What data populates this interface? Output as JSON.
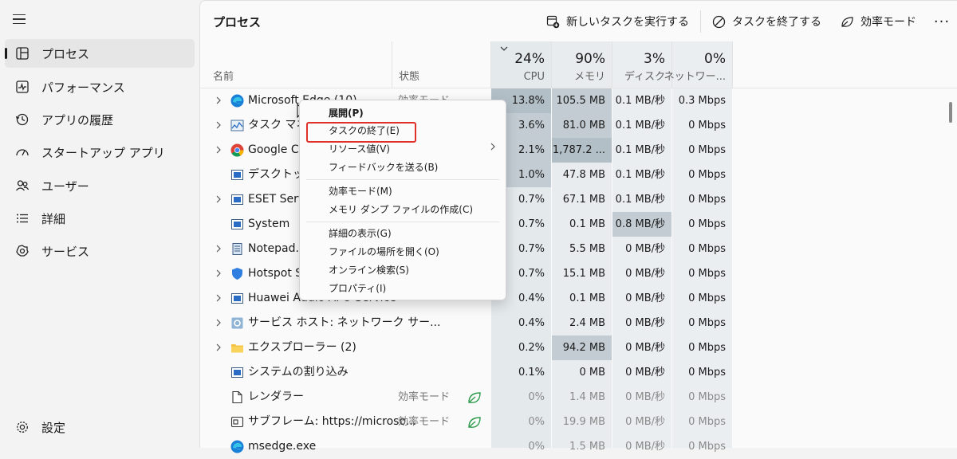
{
  "sidebar": {
    "items": [
      {
        "label": "プロセス",
        "icon": "processes-icon"
      },
      {
        "label": "パフォーマンス",
        "icon": "performance-icon"
      },
      {
        "label": "アプリの履歴",
        "icon": "history-icon"
      },
      {
        "label": "スタートアップ アプリ",
        "icon": "startup-icon"
      },
      {
        "label": "ユーザー",
        "icon": "users-icon"
      },
      {
        "label": "詳細",
        "icon": "details-icon"
      },
      {
        "label": "サービス",
        "icon": "services-icon"
      }
    ],
    "settings_label": "設定"
  },
  "header": {
    "title": "プロセス",
    "run_task": "新しいタスクを実行する",
    "end_task": "タスクを終了する",
    "efficiency": "効率モード",
    "more": "···"
  },
  "columns": {
    "name": "名前",
    "status": "状態",
    "cpu_pct": "24%",
    "cpu": "CPU",
    "mem_pct": "90%",
    "mem": "メモリ",
    "disk_pct": "3%",
    "disk": "ディスク",
    "net_pct": "0%",
    "net": "ネットワー..."
  },
  "processes": [
    {
      "name": "Microsoft Edge (10)",
      "status": "効率モード",
      "cpu": "13.8%",
      "mem": "105.5 MB",
      "disk": "0.1 MB/秒",
      "net": "0.3 Mbps"
    },
    {
      "name": "タスク マネージャー",
      "status": "",
      "cpu": "3.6%",
      "mem": "81.0 MB",
      "disk": "0.1 MB/秒",
      "net": "0 Mbps"
    },
    {
      "name": "Google Chrome",
      "status": "",
      "cpu": "2.1%",
      "mem": "1,787.2 ...",
      "disk": "0.1 MB/秒",
      "net": "0 Mbps"
    },
    {
      "name": "デスクトップ ウィンドウ マネージャー",
      "status": "",
      "cpu": "1.0%",
      "mem": "47.8 MB",
      "disk": "0.1 MB/秒",
      "net": "0 Mbps"
    },
    {
      "name": "ESET Service",
      "status": "",
      "cpu": "0.7%",
      "mem": "67.1 MB",
      "disk": "0.1 MB/秒",
      "net": "0 Mbps"
    },
    {
      "name": "System",
      "status": "",
      "cpu": "0.7%",
      "mem": "0.1 MB",
      "disk": "0.8 MB/秒",
      "net": "0 Mbps"
    },
    {
      "name": "Notepad.exe",
      "status": "",
      "cpu": "0.7%",
      "mem": "5.5 MB",
      "disk": "0 MB/秒",
      "net": "0 Mbps"
    },
    {
      "name": "Hotspot Shield",
      "status": "",
      "cpu": "0.7%",
      "mem": "15.1 MB",
      "disk": "0 MB/秒",
      "net": "0 Mbps"
    },
    {
      "name": "Huawei Audio APO Service",
      "status": "",
      "cpu": "0.4%",
      "mem": "0.1 MB",
      "disk": "0 MB/秒",
      "net": "0 Mbps"
    },
    {
      "name": "サービス ホスト: ネットワーク サー...",
      "status": "",
      "cpu": "0.4%",
      "mem": "2.4 MB",
      "disk": "0 MB/秒",
      "net": "0 Mbps"
    },
    {
      "name": "エクスプローラー (2)",
      "status": "",
      "cpu": "0.2%",
      "mem": "94.2 MB",
      "disk": "0 MB/秒",
      "net": "0 Mbps"
    },
    {
      "name": "システムの割り込み",
      "status": "",
      "cpu": "0.1%",
      "mem": "0 MB",
      "disk": "0 MB/秒",
      "net": "0 Mbps"
    },
    {
      "name": "レンダラー",
      "status": "効率モード",
      "cpu": "0%",
      "mem": "1.4 MB",
      "disk": "0 MB/秒",
      "net": "0 Mbps"
    },
    {
      "name": "サブフレーム: https://microso...",
      "status": "効率モード",
      "cpu": "0%",
      "mem": "19.9 MB",
      "disk": "0 MB/秒",
      "net": "0 Mbps"
    },
    {
      "name": "msedge.exe",
      "status": "",
      "cpu": "0%",
      "mem": "1.5 MB",
      "disk": "0 MB/秒",
      "net": "0 Mbps"
    }
  ],
  "context_menu": {
    "items": [
      "展開(P)",
      "タスクの終了(E)",
      "リソース値(V)",
      "フィードバックを送る(B)",
      "効率モード(M)",
      "メモリ ダンプ ファイルの作成(C)",
      "詳細の表示(G)",
      "ファイルの場所を開く(O)",
      "オンライン検索(S)",
      "プロパティ(I)"
    ]
  },
  "colors": {
    "highlight": "#e0302a",
    "heat_low": "#d7dfe3",
    "heat_mid": "#c2ccd2",
    "heat_high": "#b3bfc7"
  }
}
